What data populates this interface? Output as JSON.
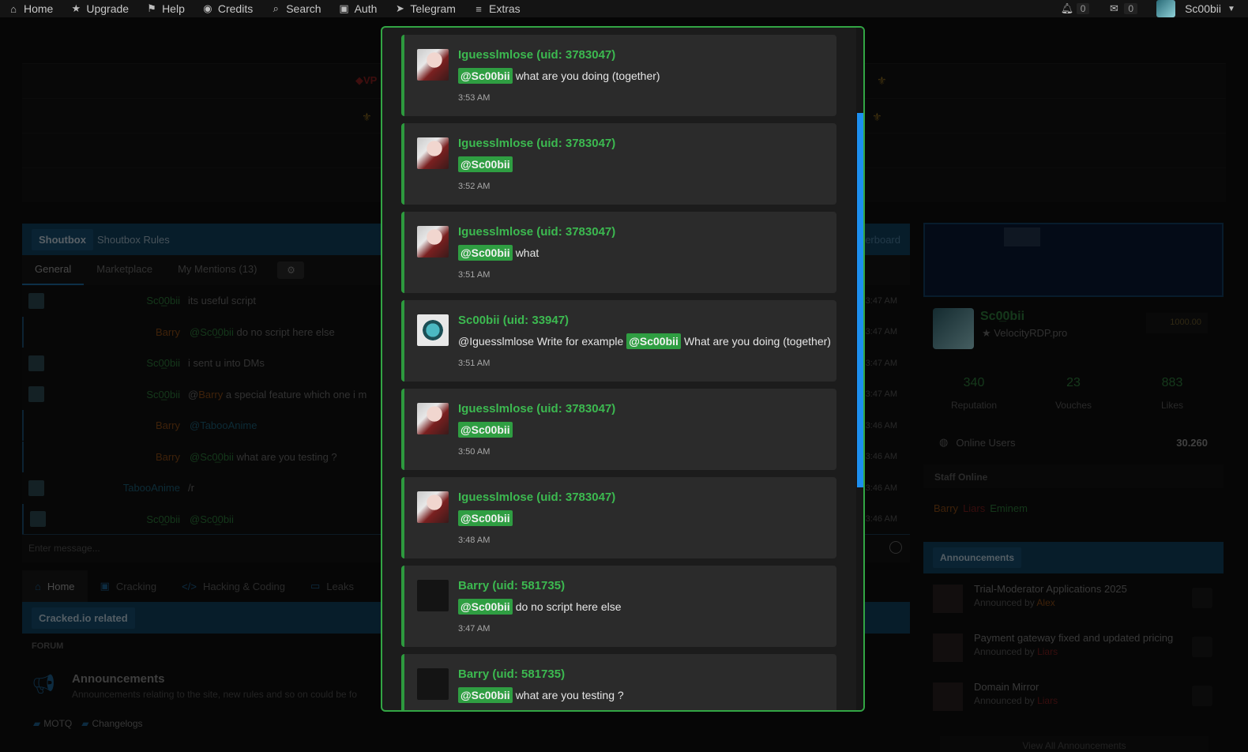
{
  "topnav": {
    "items": [
      {
        "icon": "home-icon",
        "glyph": "⌂",
        "label": "Home"
      },
      {
        "icon": "star-icon",
        "glyph": "★",
        "label": "Upgrade"
      },
      {
        "icon": "flag-icon",
        "glyph": "⚑",
        "label": "Help"
      },
      {
        "icon": "coins-icon",
        "glyph": "◉",
        "label": "Credits"
      },
      {
        "icon": "search-icon",
        "glyph": "⌕",
        "label": "Search"
      },
      {
        "icon": "lock-icon",
        "glyph": "▣",
        "label": "Auth"
      },
      {
        "icon": "telegram-icon",
        "glyph": "➤",
        "label": "Telegram"
      },
      {
        "icon": "menu-icon",
        "glyph": "≡",
        "label": "Extras"
      }
    ],
    "notifications": "0",
    "inbox": "0",
    "username": "Sc00bii"
  },
  "banners": {
    "vp": "◆VP",
    "fleur": "⚜"
  },
  "shoutbox": {
    "title": "Shoutbox",
    "rules": "Shoutbox Rules",
    "right_link": "erboard",
    "tabs": [
      "General",
      "Marketplace",
      "My Mentions (13)"
    ],
    "input_placeholder": "Enter message...",
    "rows": [
      {
        "user": "Sc0̲0bii",
        "kind": "sc",
        "pre": "",
        "mention": "",
        "msg": "its useful script",
        "time": "3:47 AM"
      },
      {
        "user": "Barry",
        "kind": "barry",
        "pre": "",
        "mention": "@Sc0̲0bii",
        "msg": "do no script here  else",
        "time": "3:47 AM"
      },
      {
        "user": "Sc0̲0bii",
        "kind": "sc",
        "pre": "",
        "mention": "",
        "msg": "i sent u into DMs",
        "time": "3:47 AM"
      },
      {
        "user": "Sc0̲0bii",
        "kind": "sc",
        "pre": "@",
        "mention": "Barry",
        "msg": "a special feature which one i m",
        "time": "3:47 AM"
      },
      {
        "user": "Barry",
        "kind": "barry",
        "pre": "",
        "mention": "@TabooAnime",
        "msg": "",
        "time": "3:46 AM"
      },
      {
        "user": "Barry",
        "kind": "barry",
        "pre": "",
        "mention": "@Sc0̲0bii",
        "msg": "what are you testing ?",
        "time": "3:46 AM"
      },
      {
        "user": "TabooAnime",
        "kind": "taboo",
        "pre": "",
        "mention": "",
        "msg": "/r",
        "time": "3:46 AM"
      },
      {
        "user": "Sc0̲0bii",
        "kind": "sc",
        "pre": "",
        "mention": "@Sc0̲0bii",
        "msg": "",
        "time": "3:46 AM"
      }
    ]
  },
  "forum": {
    "tabs": [
      {
        "icon": "home-icon",
        "glyph": "⌂",
        "label": "Home"
      },
      {
        "icon": "lock-icon",
        "glyph": "▣",
        "label": "Cracking"
      },
      {
        "icon": "code-icon",
        "glyph": "</>",
        "label": "Hacking & Coding"
      },
      {
        "icon": "laptop-icon",
        "glyph": "▭",
        "label": "Leaks"
      }
    ],
    "section": "Cracked.io related",
    "col_label": "FORUM",
    "ann_title": "Announcements",
    "ann_desc": "Announcements relating to the site, new rules and so on could be fo",
    "subforums": [
      "MOTQ",
      "Changelogs"
    ]
  },
  "profile": {
    "name": "Sc0̲0bii",
    "sub": "VelocityRDP.pro",
    "coins": "1000.00",
    "stats": [
      {
        "num": "340",
        "label": "Reputation"
      },
      {
        "num": "23",
        "label": "Vouches"
      },
      {
        "num": "883",
        "label": "Likes"
      }
    ]
  },
  "online": {
    "label": "Online Users",
    "value": "30.260"
  },
  "staff": {
    "title": "Staff Online",
    "members": [
      "Barry",
      "Liars",
      "Eminem"
    ]
  },
  "announcements": {
    "title": "Announcements",
    "items": [
      {
        "title": "Trial-Moderator Applications 2025",
        "by_label": "Announced by",
        "by": "Alex",
        "kind": "u1"
      },
      {
        "title": "Payment gateway fixed and updated pricing",
        "by_label": "Announced by",
        "by": "Liars",
        "kind": "u2"
      },
      {
        "title": "Domain Mirror",
        "by_label": "Announced by",
        "by": "Liars",
        "kind": "u2"
      }
    ],
    "view_all": "View All Announcements"
  },
  "modal": {
    "messages": [
      {
        "name": "Iguesslmlose (uid: 3783047)",
        "avatar": "anime",
        "pre": "",
        "tag": "@Sc00bii",
        "text": "what are you doing (together)",
        "time": "3:53 AM"
      },
      {
        "name": "Iguesslmlose (uid: 3783047)",
        "avatar": "anime",
        "pre": "",
        "tag": "@Sc00bii",
        "text": "",
        "time": "3:52 AM"
      },
      {
        "name": "Iguesslmlose (uid: 3783047)",
        "avatar": "anime",
        "pre": "",
        "tag": "@Sc00bii",
        "text": "what",
        "time": "3:51 AM"
      },
      {
        "name": "Sc00bii (uid: 33947)",
        "avatar": "logo",
        "pre": "@Iguesslmlose Write for example",
        "tag": "@Sc00bii",
        "text": "What are you doing (together)",
        "time": "3:51 AM"
      },
      {
        "name": "Iguesslmlose (uid: 3783047)",
        "avatar": "anime",
        "pre": "",
        "tag": "@Sc00bii",
        "text": "",
        "time": "3:50 AM"
      },
      {
        "name": "Iguesslmlose (uid: 3783047)",
        "avatar": "anime",
        "pre": "",
        "tag": "@Sc00bii",
        "text": "",
        "time": "3:48 AM"
      },
      {
        "name": "Barry (uid: 581735)",
        "avatar": "blank",
        "pre": "",
        "tag": "@Sc00bii",
        "text": "do no script here else",
        "time": "3:47 AM"
      },
      {
        "name": "Barry (uid: 581735)",
        "avatar": "blank",
        "pre": "",
        "tag": "@Sc00bii",
        "text": "what are you testing ?",
        "time": ""
      }
    ]
  }
}
